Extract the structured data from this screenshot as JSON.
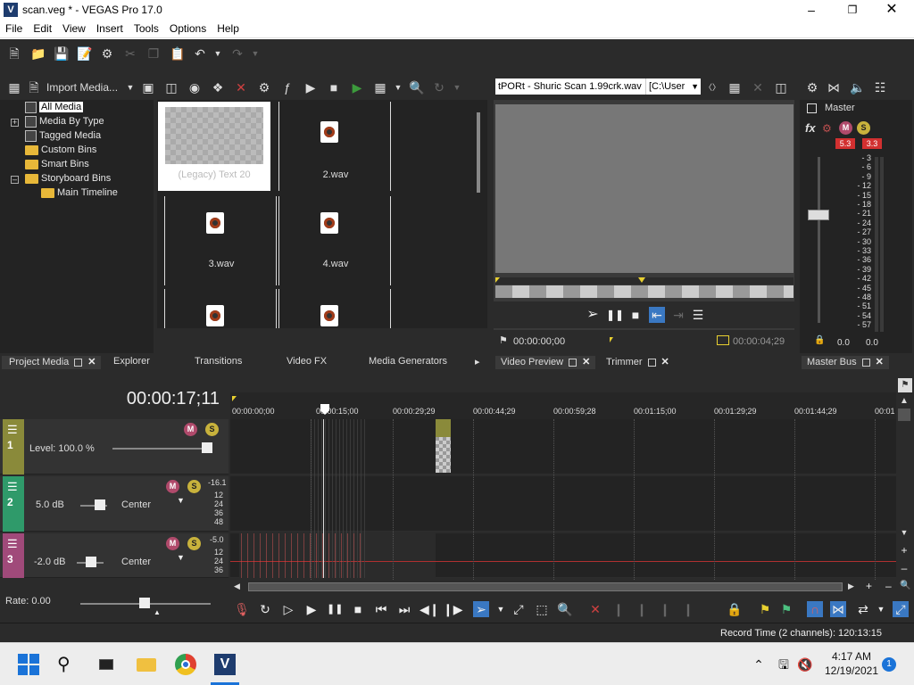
{
  "window": {
    "title": "scan.veg * - VEGAS Pro 17.0",
    "app_icon": "V"
  },
  "menu": [
    "File",
    "Edit",
    "View",
    "Insert",
    "Tools",
    "Options",
    "Help"
  ],
  "project_media": {
    "import_label": "Import Media...",
    "tree": [
      {
        "label": "All Media",
        "selected": true
      },
      {
        "label": "Media By Type"
      },
      {
        "label": "Tagged Media"
      },
      {
        "label": "Custom Bins"
      },
      {
        "label": "Smart Bins"
      },
      {
        "label": "Storyboard Bins"
      },
      {
        "label": "Main Timeline"
      }
    ],
    "items": [
      {
        "label": "(Legacy) Text 20"
      },
      {
        "label": "2.wav"
      },
      {
        "label": "3.wav"
      },
      {
        "label": "4.wav"
      }
    ]
  },
  "panel_tabs": {
    "left": [
      "Project Media",
      "Explorer",
      "Transitions",
      "Video FX",
      "Media Generators"
    ],
    "middle": [
      "Video Preview",
      "Trimmer"
    ],
    "right": [
      "Master Bus"
    ]
  },
  "trimmer": {
    "file": "tPORt - Shuric Scan 1.99crk.wav",
    "path": "[C:\\User",
    "start": "00:00:00;00",
    "end": "00:00:04;29"
  },
  "master": {
    "label": "Master",
    "fx": "fx",
    "peak_left": "5.3",
    "peak_right": "3.3",
    "scale": [
      "3",
      "6",
      "9",
      "12",
      "15",
      "18",
      "21",
      "24",
      "27",
      "30",
      "33",
      "36",
      "39",
      "42",
      "45",
      "48",
      "51",
      "54",
      "57"
    ],
    "level_left": "0.0",
    "level_right": "0.0"
  },
  "timeline": {
    "cursor": "00:00:17;11",
    "ruler": [
      "00:00:00;00",
      "00:00:15;00",
      "00:00:29;29",
      "00:00:44;29",
      "00:00:59;28",
      "00:01:15;00",
      "00:01:29;29",
      "00:01:44;29",
      "00:01"
    ],
    "tracks": [
      {
        "num": "1",
        "label": "Level: 100.0 %",
        "color": "#8a8a3a"
      },
      {
        "num": "2",
        "vol": "5.0 dB",
        "pan": "Center",
        "meter": "-16.1",
        "scale": [
          "12",
          "24",
          "36",
          "48"
        ],
        "color": "#2f9a6a"
      },
      {
        "num": "3",
        "vol": "-2.0 dB",
        "pan": "Center",
        "meter": "-5.0",
        "scale": [
          "12",
          "24",
          "36"
        ],
        "color": "#a04a7a"
      }
    ],
    "rate": "Rate: 0.00"
  },
  "status": {
    "record_time": "Record Time (2 channels): 120:13:15"
  },
  "taskbar": {
    "time": "4:17 AM",
    "date": "12/19/2021",
    "badge": "1"
  }
}
